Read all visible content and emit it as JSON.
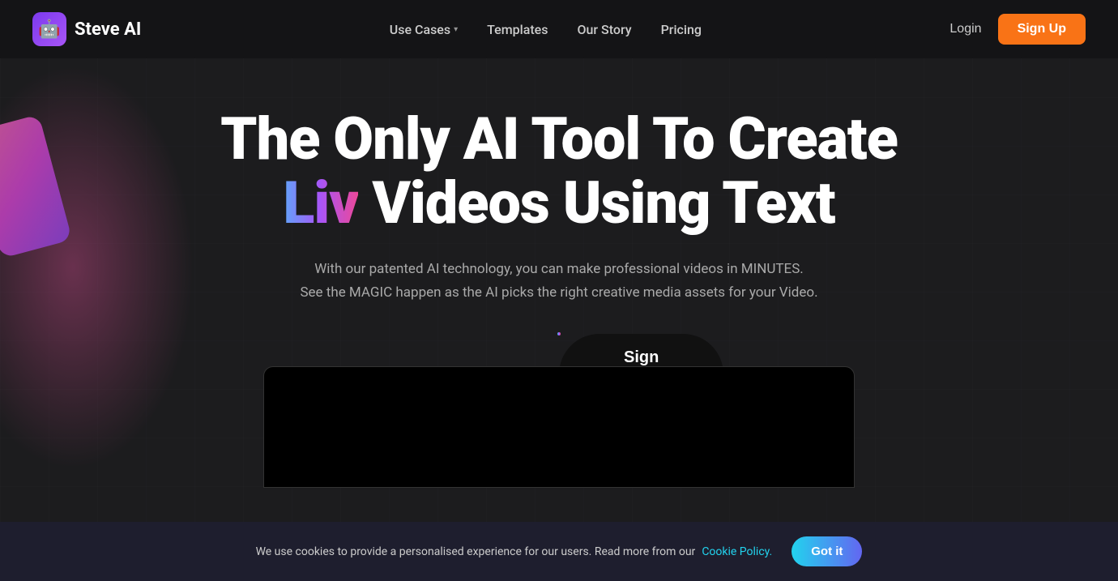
{
  "navbar": {
    "logo_text": "Steve AI",
    "nav_items": [
      {
        "label": "Use Cases",
        "has_chevron": true,
        "id": "use-cases"
      },
      {
        "label": "Templates",
        "has_chevron": false,
        "id": "templates"
      },
      {
        "label": "Our Story",
        "has_chevron": false,
        "id": "our-story"
      },
      {
        "label": "Pricing",
        "has_chevron": false,
        "id": "pricing"
      }
    ],
    "login_label": "Login",
    "signup_label": "Sign Up"
  },
  "hero": {
    "title_line1": "The Only AI Tool To Create",
    "title_liv": "Liv",
    "title_line2_rest": " Videos Using Text",
    "subtitle_line1": "With our patented AI technology, you can make professional videos in MINUTES.",
    "subtitle_line2": "See the MAGIC happen as the AI picks the right creative media assets for your Video.",
    "cta_label": "Sign Up For Free"
  },
  "cookie": {
    "message": "We use cookies to provide a personalised experience for our users. Read more from our",
    "link_text": "Cookie Policy.",
    "button_label": "Got it"
  }
}
